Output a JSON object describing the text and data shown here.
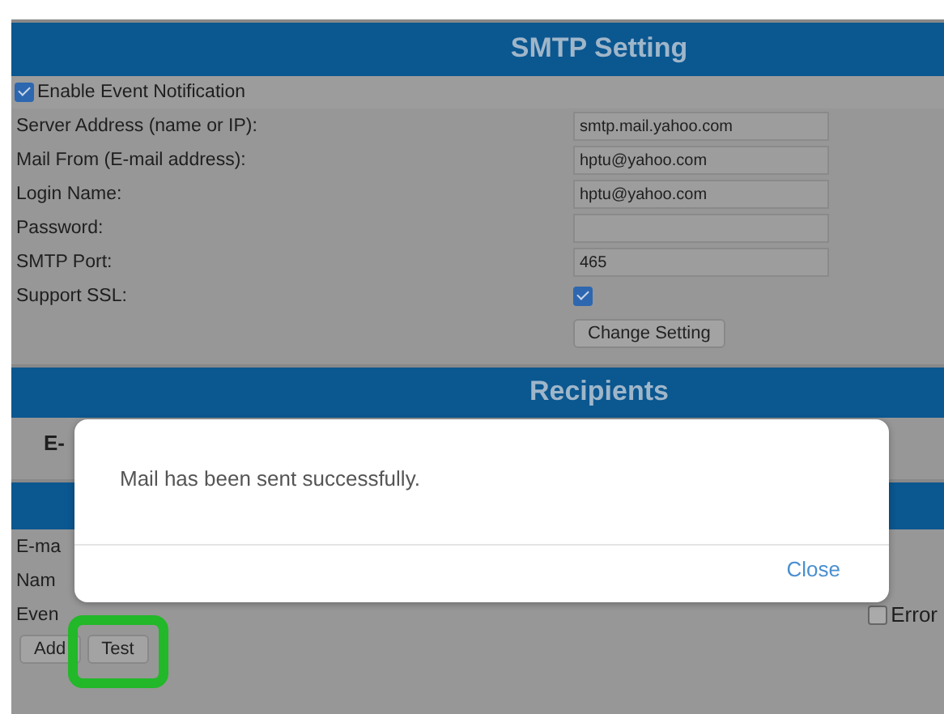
{
  "smtp": {
    "title": "SMTP Setting",
    "enable": {
      "label": "Enable Event Notification",
      "checked": true
    },
    "fields": [
      {
        "kind": "text",
        "label": "Server Address (name or IP):",
        "value": "smtp.mail.yahoo.com"
      },
      {
        "kind": "text",
        "label": "Mail From (E-mail address):",
        "value": "hptu@yahoo.com"
      },
      {
        "kind": "text",
        "label": "Login Name:",
        "value": "hptu@yahoo.com"
      },
      {
        "kind": "text",
        "label": "Password:"
      },
      {
        "kind": "text",
        "label": "SMTP Port:",
        "value": "465"
      },
      {
        "kind": "checkbox",
        "label": "Support SSL:",
        "checked": true
      }
    ],
    "button": "Change Setting"
  },
  "recipients": {
    "title": "Recipients",
    "column_1": "E-",
    "rows": [
      {
        "kind": "text",
        "label": "E-ma"
      },
      {
        "kind": "text",
        "label": "Nam"
      },
      {
        "kind": "events",
        "label": "Even",
        "options": [
          {
            "label": "Error",
            "checked": false
          }
        ]
      }
    ],
    "buttons": [
      {
        "label": "Add",
        "highlighted": false
      },
      {
        "label": "Test",
        "highlighted": true
      }
    ]
  },
  "dialog": {
    "message": "Mail has been sent successfully.",
    "button": "Close"
  }
}
